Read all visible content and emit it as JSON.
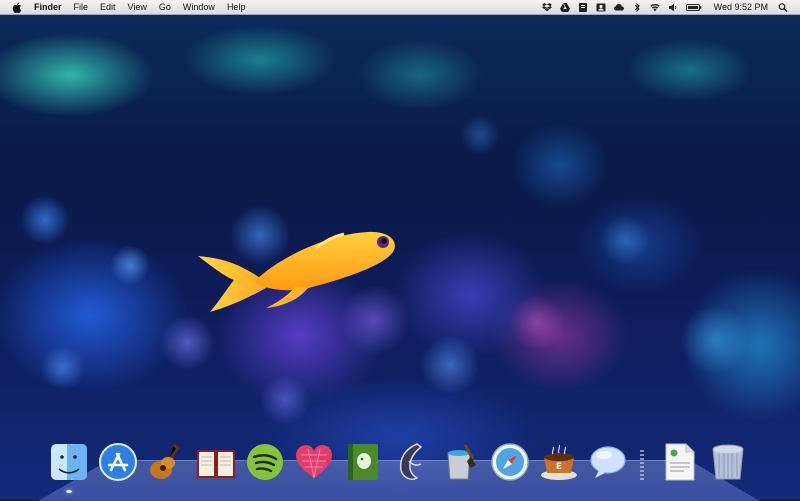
{
  "menubar": {
    "app_name": "Finder",
    "menus": [
      "File",
      "Edit",
      "View",
      "Go",
      "Window",
      "Help"
    ],
    "status_icons": [
      "dropbox-icon",
      "google-drive-icon",
      "evernote-icon",
      "contacts-icon",
      "cloud-icon",
      "bluetooth-icon",
      "wifi-icon",
      "volume-icon",
      "battery-icon"
    ],
    "clock": "Wed 9:52 PM",
    "search_icon": "spotlight-icon"
  },
  "wallpaper": {
    "subject": "goldfish-icon"
  },
  "dock": {
    "items": [
      {
        "icon": "finder-icon",
        "running": true
      },
      {
        "icon": "app-store-icon",
        "running": false
      },
      {
        "icon": "garageband-icon",
        "running": false
      },
      {
        "icon": "dictionary-icon",
        "running": false
      },
      {
        "icon": "spotify-icon",
        "running": false
      },
      {
        "icon": "heart-app-icon",
        "running": false
      },
      {
        "icon": "evernote-icon",
        "running": false
      },
      {
        "icon": "dashcode-icon",
        "running": false
      },
      {
        "icon": "paint-bucket-icon",
        "running": false
      },
      {
        "icon": "safari-icon",
        "running": false
      },
      {
        "icon": "coffee-cup-icon",
        "running": false
      },
      {
        "icon": "messages-icon",
        "running": false
      },
      {
        "icon": "dock-separator",
        "running": false
      },
      {
        "icon": "document-icon",
        "running": false
      },
      {
        "icon": "trash-icon",
        "running": false
      }
    ]
  },
  "colors": {
    "menubar": "#e8e8e8",
    "fish": "#ffb21e",
    "wallpaper_dark": "#0a1b48"
  }
}
